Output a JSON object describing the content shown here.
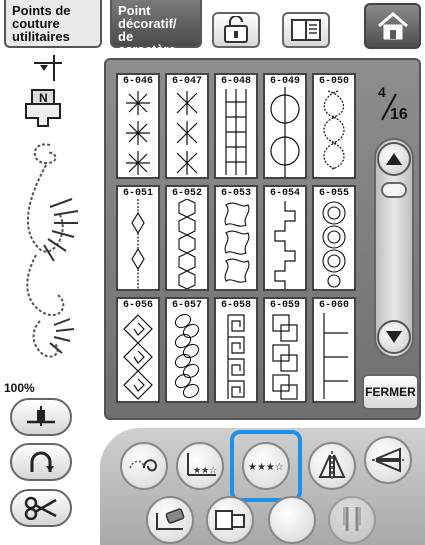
{
  "tabs": {
    "utility": "Points de couture utilitaires",
    "decorative_line1": "Point",
    "decorative_line2": "décoratif/",
    "decorative_line3": "de caractère"
  },
  "icons": {
    "unlock": "unlock-icon",
    "book": "manual-book-icon",
    "home": "home-icon",
    "needle": "needle-position-icon",
    "foot": "presser-foot-icon",
    "scroll_up": "triangle-up-icon",
    "scroll_down": "triangle-down-icon"
  },
  "presser_foot_letter": "N",
  "zoom": "100%",
  "page": {
    "current": "4",
    "total": "16"
  },
  "close_label": "FERMER",
  "stitches": [
    {
      "code": "6-046",
      "motif": "sunburst"
    },
    {
      "code": "6-047",
      "motif": "snowflake"
    },
    {
      "code": "6-048",
      "motif": "ladder"
    },
    {
      "code": "6-049",
      "motif": "circles"
    },
    {
      "code": "6-050",
      "motif": "scallop"
    },
    {
      "code": "6-051",
      "motif": "diamonds"
    },
    {
      "code": "6-052",
      "motif": "honeycomb"
    },
    {
      "code": "6-053",
      "motif": "puzzle"
    },
    {
      "code": "6-054",
      "motif": "steps"
    },
    {
      "code": "6-055",
      "motif": "domes"
    },
    {
      "code": "6-056",
      "motif": "spiral-diamonds"
    },
    {
      "code": "6-057",
      "motif": "chain"
    },
    {
      "code": "6-058",
      "motif": "greek-key"
    },
    {
      "code": "6-059",
      "motif": "blocks"
    },
    {
      "code": "6-060",
      "motif": "comb"
    }
  ],
  "colors": {
    "panel": "#7d7d7d",
    "highlight": "#1e90e8",
    "tray": "#bdbdbd"
  }
}
